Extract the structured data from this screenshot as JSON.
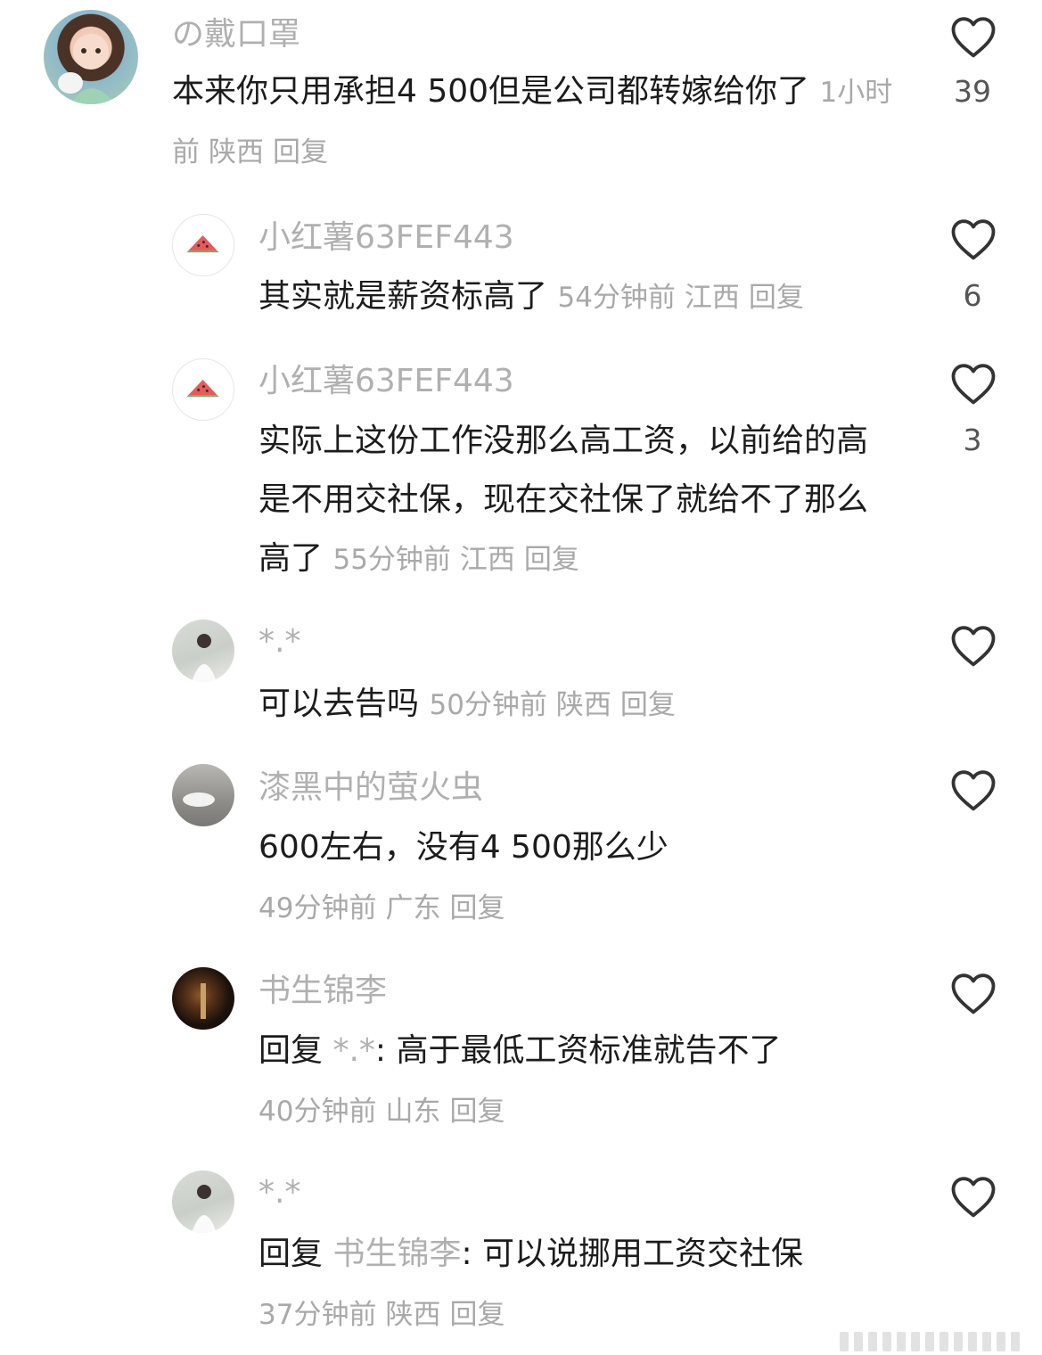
{
  "comments": [
    {
      "username": "の戴口罩",
      "text": "本来你只用承担4  500但是公司都转嫁给你了",
      "time": "1小时前",
      "location": "陕西",
      "reply": "回复",
      "likes": "39"
    },
    {
      "username": "小红薯63FEF443",
      "text": "其实就是薪资标高了",
      "time": "54分钟前",
      "location": "江西",
      "reply": "回复",
      "likes": "6"
    },
    {
      "username": "小红薯63FEF443",
      "text": "实际上这份工作没那么高工资，以前给的高是不用交社保，现在交社保了就给不了那么高了",
      "time": "55分钟前",
      "location": "江西",
      "reply": "回复",
      "likes": "3"
    },
    {
      "username": "*.*",
      "text": "可以去告吗",
      "time": "50分钟前",
      "location": "陕西",
      "reply": "回复",
      "likes": ""
    },
    {
      "username": "漆黑中的萤火虫",
      "text": "600左右，没有4 500那么少",
      "time": "49分钟前",
      "location": "广东",
      "reply": "回复",
      "likes": ""
    },
    {
      "username": "书生锦李",
      "reply_prefix": "回复",
      "reply_target": "*.*",
      "text": ": 高于最低工资标准就告不了",
      "time": "40分钟前",
      "location": "山东",
      "reply": "回复",
      "likes": ""
    },
    {
      "username": "*.*",
      "reply_prefix": "回复",
      "reply_target": "书生锦李",
      "text": ": 可以说挪用工资交社保",
      "time": "37分钟前",
      "location": "陕西",
      "reply": "回复",
      "likes": ""
    }
  ],
  "icons": {
    "like": "heart-outline-icon"
  },
  "colors": {
    "username": "#b0b0b0",
    "text": "#1c1c1c",
    "meta": "#a9a9a9"
  }
}
